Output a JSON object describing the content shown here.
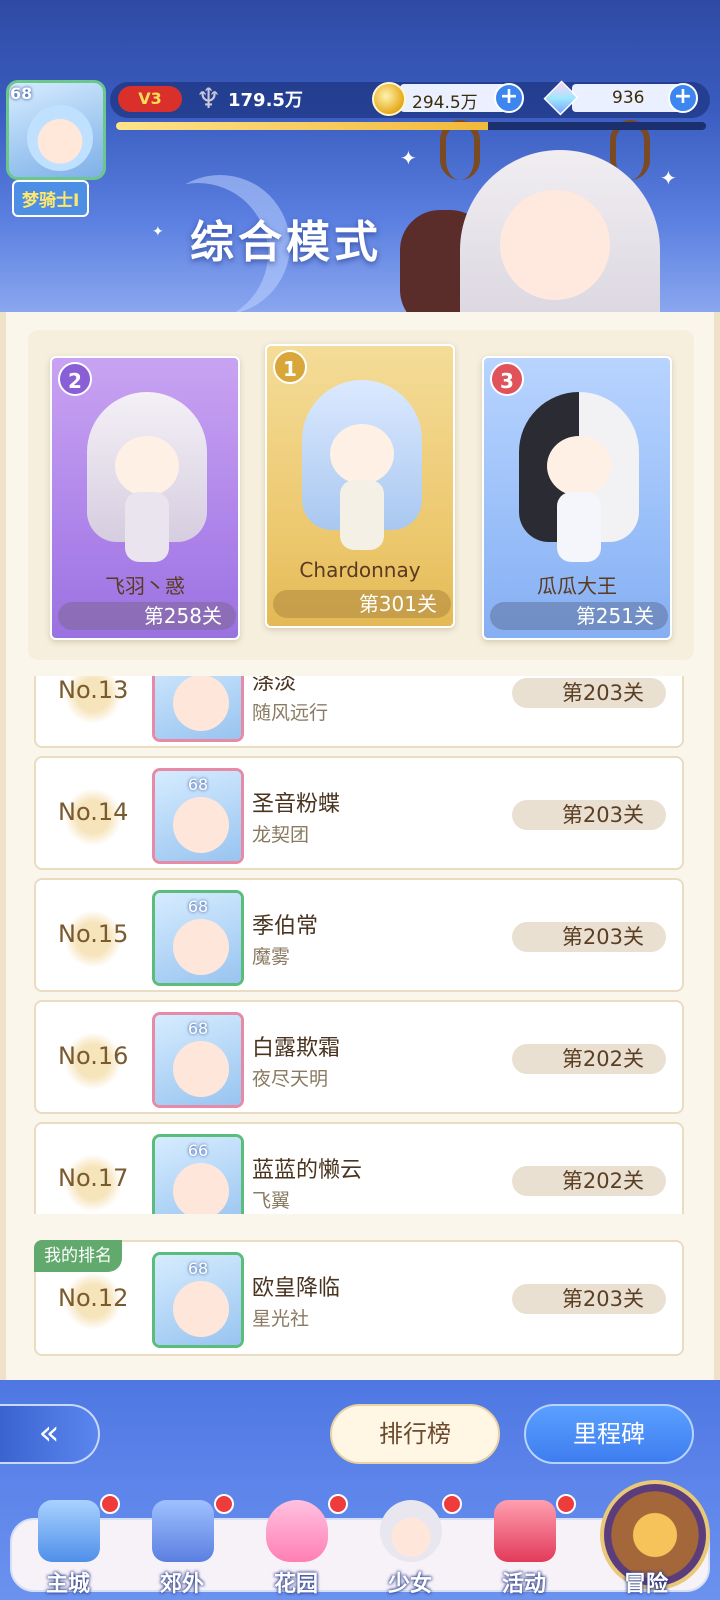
{
  "header": {
    "avatar_level": "68",
    "username": "梦骑士I",
    "vip": "V3",
    "power": "179.5万",
    "gold": "294.5万",
    "gems": "936",
    "exp_progress": 0.63,
    "mode_title": "综合模式",
    "plus": "+"
  },
  "podium": [
    {
      "rank": "2",
      "name": "飞羽丶惑",
      "stage": "第258关"
    },
    {
      "rank": "1",
      "name": "Chardonnay",
      "stage": "第301关"
    },
    {
      "rank": "3",
      "name": "瓜瓜大王",
      "stage": "第251关"
    }
  ],
  "list": [
    {
      "rank": "No.13",
      "level": "",
      "name": "涤淡",
      "guild": "随风远行",
      "stage": "第203关"
    },
    {
      "rank": "No.14",
      "level": "68",
      "name": "圣音粉蝶",
      "guild": "龙契团",
      "stage": "第203关"
    },
    {
      "rank": "No.15",
      "level": "68",
      "name": "季伯常",
      "guild": "魔雾",
      "stage": "第203关"
    },
    {
      "rank": "No.16",
      "level": "68",
      "name": "白露欺霜",
      "guild": "夜尽天明",
      "stage": "第202关"
    },
    {
      "rank": "No.17",
      "level": "66",
      "name": "蓝蓝的懒云",
      "guild": "飞翼",
      "stage": "第202关"
    }
  ],
  "my_rank": {
    "tag": "我的排名",
    "rank": "No.12",
    "level": "68",
    "name": "欧皇降临",
    "guild": "星光社",
    "stage": "第203关"
  },
  "buttons": {
    "back": "«",
    "leaderboard": "排行榜",
    "milestone": "里程碑"
  },
  "nav": [
    {
      "label": "主城"
    },
    {
      "label": "郊外"
    },
    {
      "label": "花园"
    },
    {
      "label": "少女"
    },
    {
      "label": "活动"
    },
    {
      "label": "冒险"
    }
  ]
}
